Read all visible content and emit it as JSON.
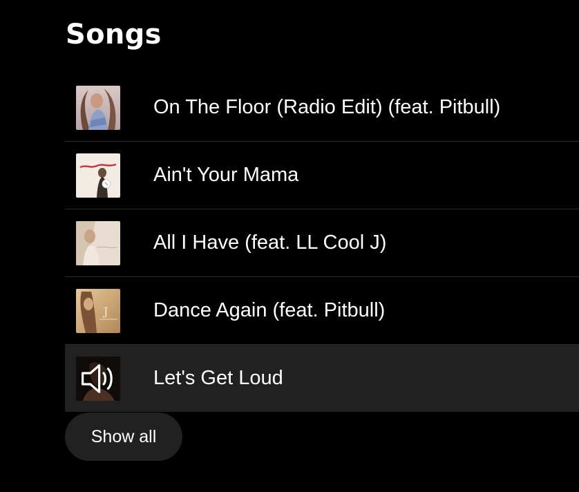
{
  "section": {
    "title": "Songs",
    "show_all_label": "Show all"
  },
  "songs": [
    {
      "title": "On The Floor (Radio Edit) (feat. Pitbull)",
      "playing": false
    },
    {
      "title": "Ain't Your Mama",
      "playing": false
    },
    {
      "title": "All I Have (feat. LL Cool J)",
      "playing": false
    },
    {
      "title": "Dance Again (feat. Pitbull)",
      "playing": false
    },
    {
      "title": "Let's Get Loud",
      "playing": true
    }
  ],
  "colors": {
    "background": "#000000",
    "row_highlight": "#212121",
    "divider": "#2a2a2a",
    "text": "#ffffff"
  },
  "icons": {
    "now_playing": "speaker-icon"
  }
}
